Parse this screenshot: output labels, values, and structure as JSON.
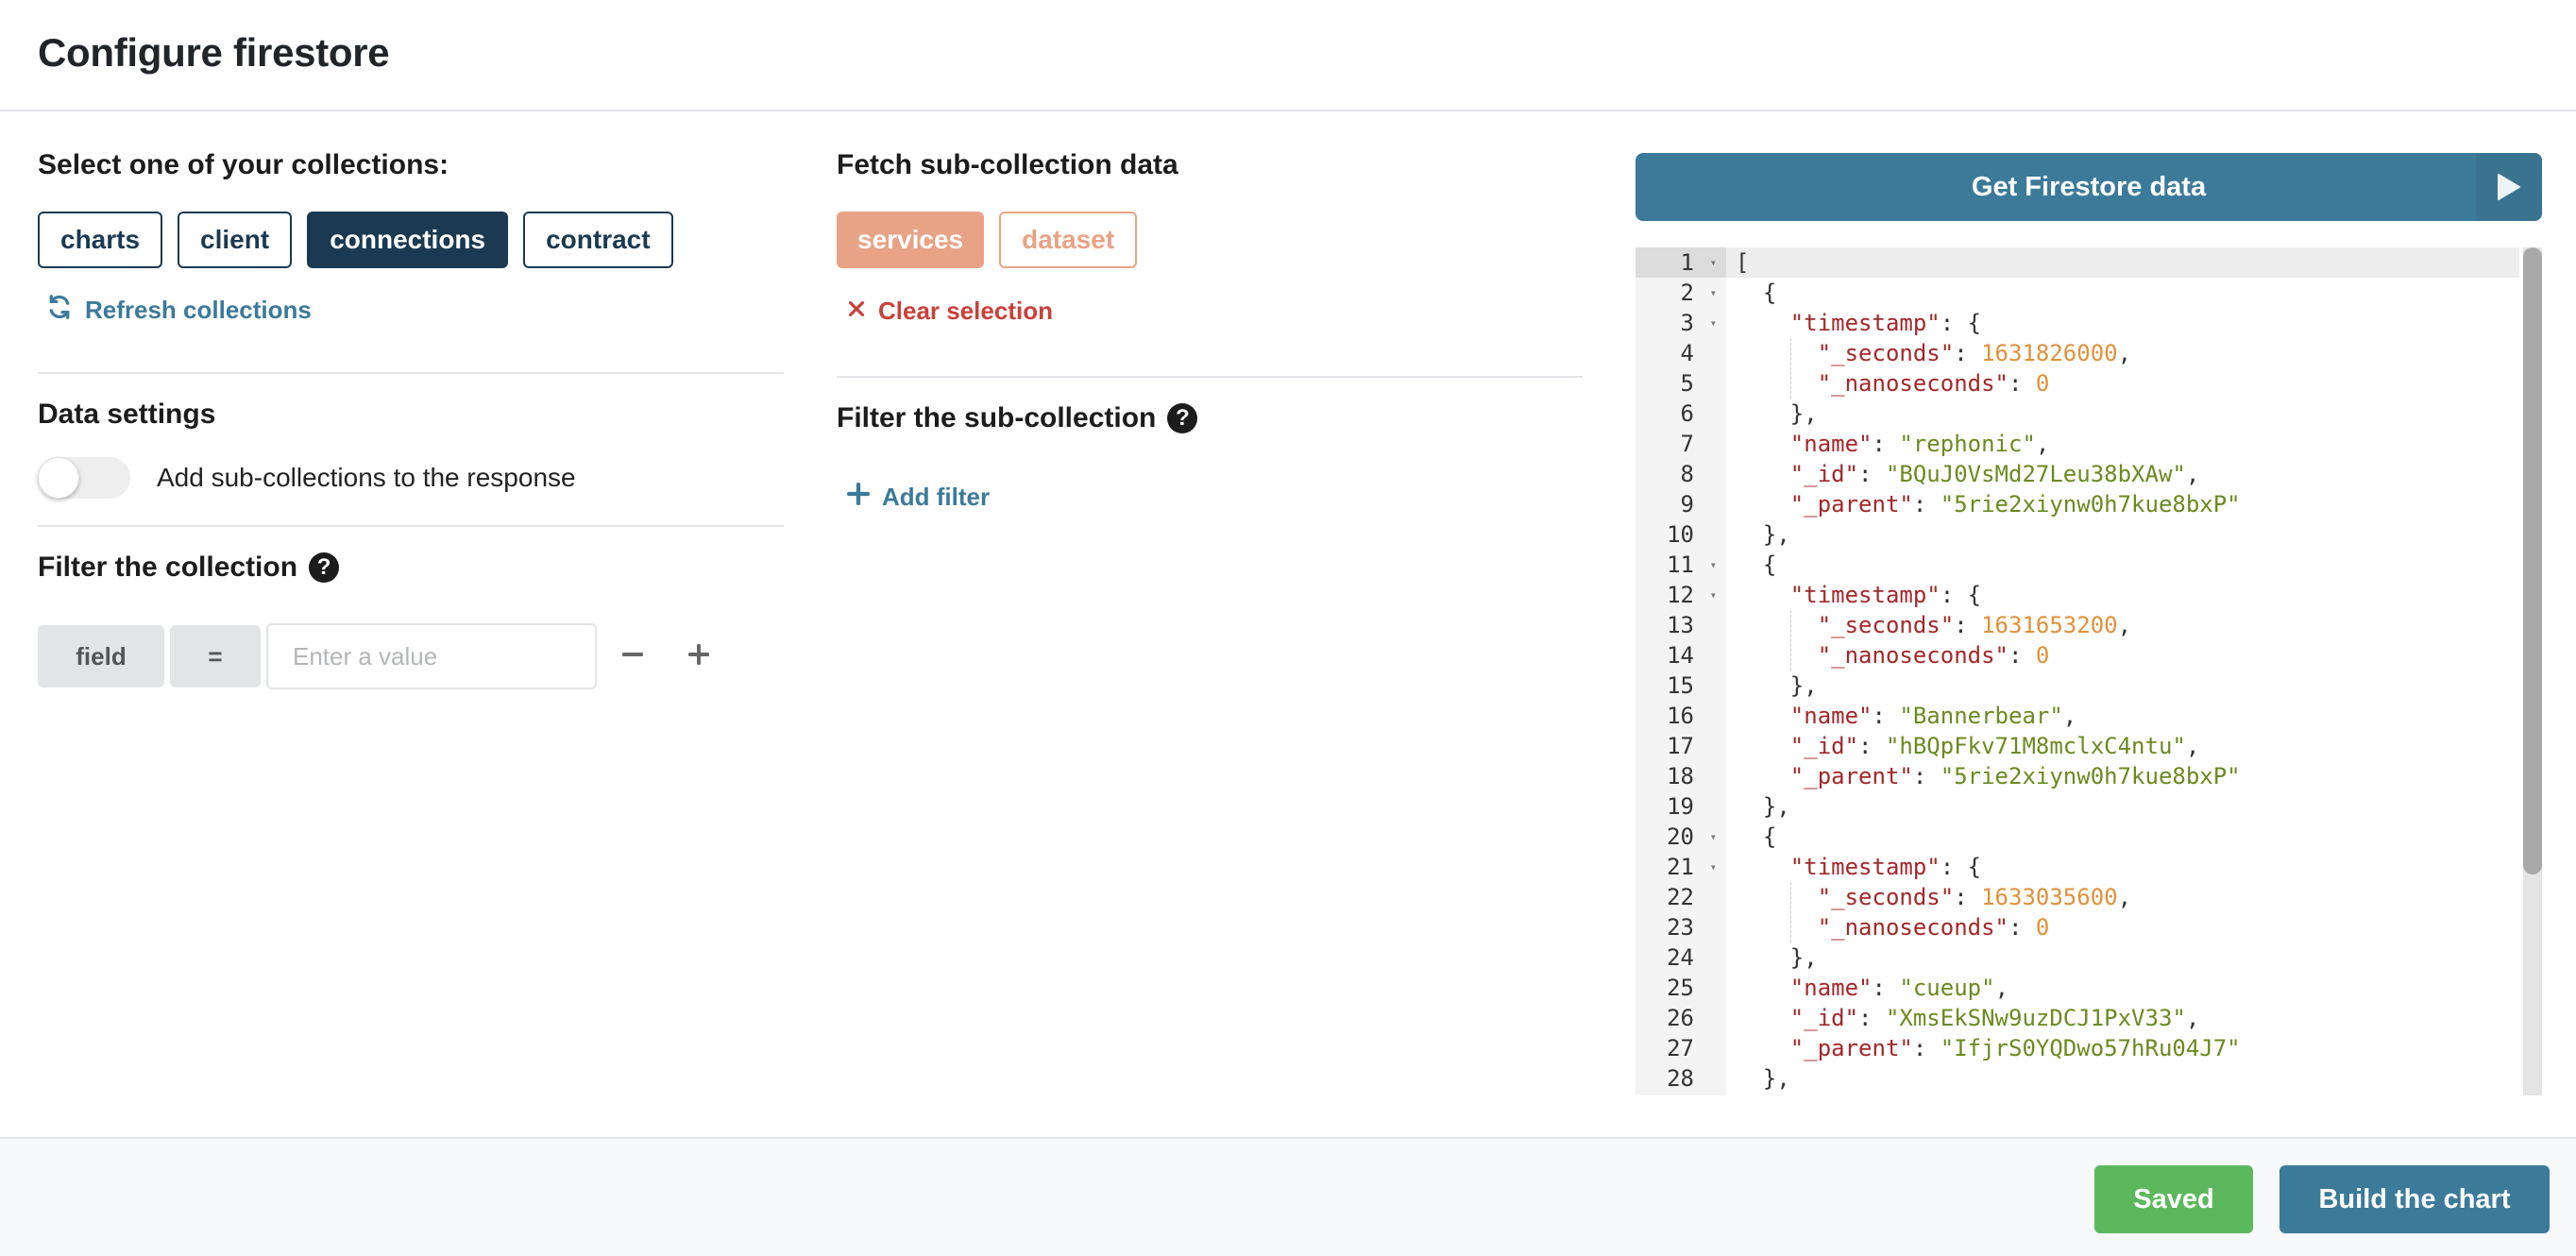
{
  "header": {
    "title": "Configure firestore"
  },
  "collections": {
    "heading": "Select one of your collections:",
    "items": [
      {
        "label": "charts",
        "selected": false
      },
      {
        "label": "client",
        "selected": false
      },
      {
        "label": "connections",
        "selected": true
      },
      {
        "label": "contract",
        "selected": false
      }
    ],
    "refresh_label": "Refresh collections"
  },
  "data_settings": {
    "heading": "Data settings",
    "toggle_label": "Add sub-collections to the response",
    "toggle_on": false
  },
  "filter_collection": {
    "heading": "Filter the collection",
    "field_label": "field",
    "operator_label": "=",
    "value_placeholder": "Enter a value",
    "value": ""
  },
  "sub_collection": {
    "heading": "Fetch sub-collection data",
    "items": [
      {
        "label": "services",
        "selected": true
      },
      {
        "label": "dataset",
        "selected": false
      }
    ],
    "clear_label": "Clear selection"
  },
  "filter_sub_collection": {
    "heading": "Filter the sub-collection",
    "add_filter_label": "Add filter"
  },
  "result": {
    "get_button_label": "Get Firestore data",
    "lines": [
      {
        "n": "1",
        "fold": true,
        "text": "["
      },
      {
        "n": "2",
        "fold": true,
        "text": "  {"
      },
      {
        "n": "3",
        "fold": true,
        "text": "    \"timestamp\": {"
      },
      {
        "n": "4",
        "fold": false,
        "text": "      \"_seconds\": 1631826000,"
      },
      {
        "n": "5",
        "fold": false,
        "text": "      \"_nanoseconds\": 0"
      },
      {
        "n": "6",
        "fold": false,
        "text": "    },"
      },
      {
        "n": "7",
        "fold": false,
        "text": "    \"name\": \"rephonic\","
      },
      {
        "n": "8",
        "fold": false,
        "text": "    \"_id\": \"BQuJ0VsMd27Leu38bXAw\","
      },
      {
        "n": "9",
        "fold": false,
        "text": "    \"_parent\": \"5rie2xiynw0h7kue8bxP\""
      },
      {
        "n": "10",
        "fold": false,
        "text": "  },"
      },
      {
        "n": "11",
        "fold": true,
        "text": "  {"
      },
      {
        "n": "12",
        "fold": true,
        "text": "    \"timestamp\": {"
      },
      {
        "n": "13",
        "fold": false,
        "text": "      \"_seconds\": 1631653200,"
      },
      {
        "n": "14",
        "fold": false,
        "text": "      \"_nanoseconds\": 0"
      },
      {
        "n": "15",
        "fold": false,
        "text": "    },"
      },
      {
        "n": "16",
        "fold": false,
        "text": "    \"name\": \"Bannerbear\","
      },
      {
        "n": "17",
        "fold": false,
        "text": "    \"_id\": \"hBQpFkv71M8mclxC4ntu\","
      },
      {
        "n": "18",
        "fold": false,
        "text": "    \"_parent\": \"5rie2xiynw0h7kue8bxP\""
      },
      {
        "n": "19",
        "fold": false,
        "text": "  },"
      },
      {
        "n": "20",
        "fold": true,
        "text": "  {"
      },
      {
        "n": "21",
        "fold": true,
        "text": "    \"timestamp\": {"
      },
      {
        "n": "22",
        "fold": false,
        "text": "      \"_seconds\": 1633035600,"
      },
      {
        "n": "23",
        "fold": false,
        "text": "      \"_nanoseconds\": 0"
      },
      {
        "n": "24",
        "fold": false,
        "text": "    },"
      },
      {
        "n": "25",
        "fold": false,
        "text": "    \"name\": \"cueup\","
      },
      {
        "n": "26",
        "fold": false,
        "text": "    \"_id\": \"XmsEkSNw9uzDCJ1PxV33\","
      },
      {
        "n": "27",
        "fold": false,
        "text": "    \"_parent\": \"IfjrS0YQDwo57hRu04J7\""
      },
      {
        "n": "28",
        "fold": false,
        "text": "  },"
      }
    ]
  },
  "footer": {
    "saved_label": "Saved",
    "build_label": "Build the chart"
  },
  "colors": {
    "primary": "#3c7a9a",
    "navy": "#1b3a52",
    "accent_orange": "#e8a386",
    "danger": "#c9403a",
    "success": "#5cb85c"
  }
}
